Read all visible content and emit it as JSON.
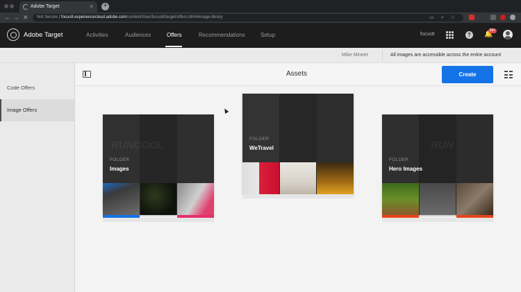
{
  "browser": {
    "tab_title": "Adobe Target",
    "tab_close": "×",
    "new_tab": "+",
    "back": "←",
    "forward": "→",
    "reload": "✕",
    "security_label": "Not Secure",
    "url_host": "focus8.experiencecloud.adobe.com",
    "url_path": "/content/mac/focus8/target/offers.html#image-library"
  },
  "app": {
    "name": "Adobe Target",
    "nav": [
      "Activities",
      "Audiences",
      "Offers",
      "Recommendations",
      "Setup"
    ],
    "active_nav": "Offers",
    "workspace": "focus8",
    "help_glyph": "?",
    "bell_glyph": "🔔",
    "notification_count": "99+"
  },
  "infobar": {
    "user": "Mike Mineer",
    "note": "All images are accessible across the entire account"
  },
  "sidebar": {
    "items": [
      {
        "label": "Code Offers"
      },
      {
        "label": "Image Offers"
      }
    ],
    "selected": "Image Offers"
  },
  "main": {
    "title": "Assets",
    "create_label": "Create"
  },
  "folders": [
    {
      "kind": "FOLDER",
      "name": "Images",
      "ghost_text": "RUNCOOL"
    },
    {
      "kind": "FOLDER",
      "name": "WeTravel",
      "ghost_text": ""
    },
    {
      "kind": "FOLDER",
      "name": "Hero Images",
      "ghost_text": "RUN"
    }
  ],
  "colors": {
    "accent": "#1473e6",
    "appbar": "#1d1d1d",
    "badge": "#e34850"
  }
}
